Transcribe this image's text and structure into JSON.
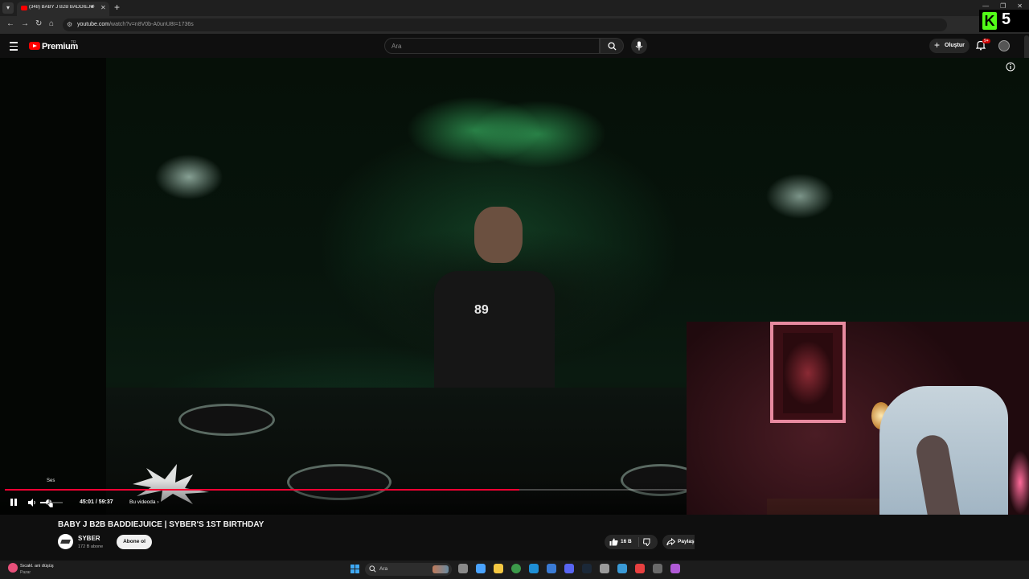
{
  "browser": {
    "tab_title": "(348) BABY J B2B BADDIEJUICE",
    "url_host": "youtube.com",
    "url_path": "/watch?v=n8V0b-A0unU8t=1736s",
    "kick_badge_letter": "K",
    "kick_badge_number": "5"
  },
  "header": {
    "brand": "Premium",
    "region": "TR",
    "search_placeholder": "Ara",
    "create_label": "Oluştur",
    "notifications_badge": "9+"
  },
  "player": {
    "volume_tooltip": "Ses",
    "time_display": "45:01 / 59:37",
    "chapter_label": "Bu videoda",
    "progress_fraction": 0.755,
    "volume_fraction": 0.35,
    "shirt_text": "89"
  },
  "video": {
    "title": "BABY J B2B BADDIEJUICE | SYBER'S 1ST BIRTHDAY",
    "channel_name": "SYBER",
    "channel_subs": "172 B abone",
    "subscribe_label": "Abone ol",
    "like_count": "16 B",
    "share_label": "Paylaş"
  },
  "taskbar": {
    "weather_title": "Sıcakl. ani düşüş",
    "weather_sub": "Pazar",
    "search_label": "Ara",
    "app_icons": [
      "file-explorer-icon",
      "copilot-icon",
      "folder-icon",
      "chrome-icon",
      "edge-icon",
      "store-icon",
      "discord-icon",
      "steam-icon",
      "settings-icon",
      "network-icon",
      "media-icon",
      "obs-icon",
      "app-icon"
    ]
  },
  "colors": {
    "accent_red": "#ff0033",
    "kick_green": "#53fc18",
    "background": "#0f0f0f"
  }
}
